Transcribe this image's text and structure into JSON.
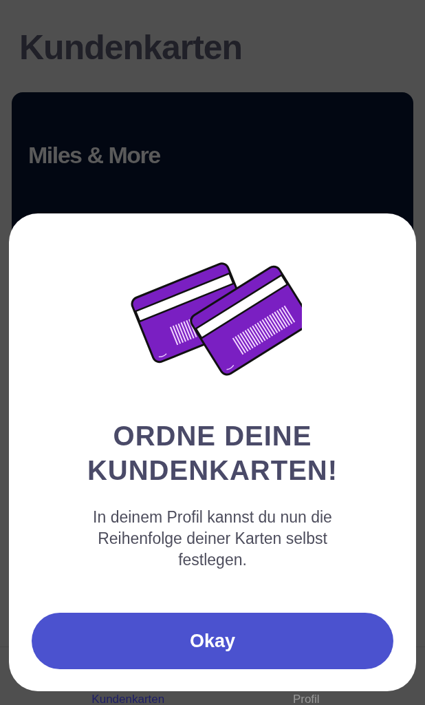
{
  "page": {
    "title": "Kundenkarten"
  },
  "card": {
    "name": "Miles & More"
  },
  "tab_bar": [
    {
      "label": "Kundenkarten",
      "selected": true
    },
    {
      "label": "Profil",
      "selected": false
    }
  ],
  "dialog": {
    "heading": "ORDNE DEINE KUNDENKARTEN!",
    "text": "In deinem Profil kannst du nun die Reihenfolge deiner Karten selbst festlegen.",
    "button": "Okay"
  }
}
